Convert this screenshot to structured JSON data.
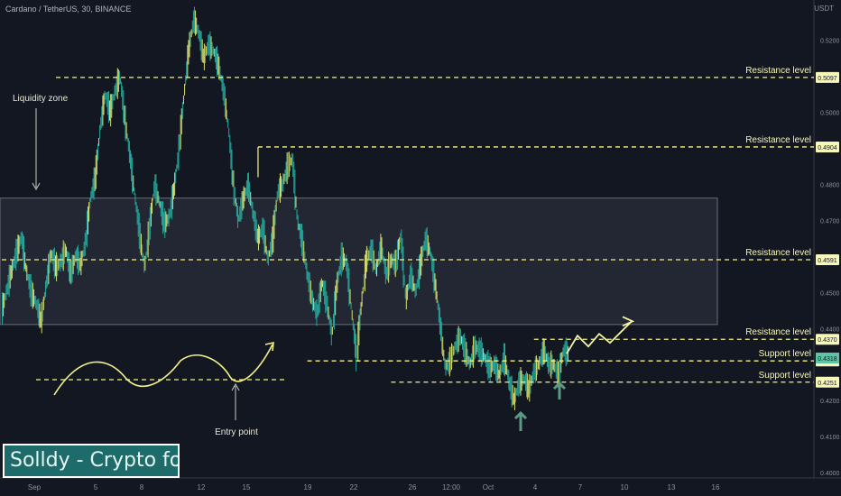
{
  "header": {
    "symbol_title": "Cardano / TetherUS, 30, BINANCE",
    "currency": "USDT"
  },
  "brand": "Solldy - Crypto for U",
  "chart_data": {
    "type": "line",
    "x": [
      "Sep",
      "5",
      "8",
      "12",
      "15",
      "19",
      "22",
      "26",
      "12:00",
      "Oct",
      "4",
      "7",
      "10",
      "13",
      "16"
    ],
    "ylim": [
      0.3985,
      0.5312
    ],
    "y_ticks": [
      "0.5200",
      "0.5000",
      "0.4800",
      "0.4700",
      "0.4500",
      "0.4400",
      "0.4200",
      "0.4100",
      "0.4000"
    ],
    "price_series": [
      0.445,
      0.4505,
      0.456,
      0.461,
      0.4655,
      0.456,
      0.45,
      0.447,
      0.442,
      0.452,
      0.461,
      0.457,
      0.4585,
      0.462,
      0.455,
      0.4605,
      0.4575,
      0.464,
      0.476,
      0.482,
      0.496,
      0.505,
      0.5,
      0.506,
      0.51,
      0.498,
      0.488,
      0.477,
      0.466,
      0.457,
      0.468,
      0.48,
      0.475,
      0.469,
      0.471,
      0.479,
      0.49,
      0.505,
      0.518,
      0.526,
      0.522,
      0.515,
      0.519,
      0.517,
      0.513,
      0.506,
      0.496,
      0.48,
      0.47,
      0.476,
      0.48,
      0.472,
      0.465,
      0.468,
      0.459,
      0.465,
      0.478,
      0.48,
      0.485,
      0.487,
      0.47,
      0.464,
      0.455,
      0.448,
      0.444,
      0.453,
      0.447,
      0.438,
      0.452,
      0.46,
      0.458,
      0.445,
      0.432,
      0.447,
      0.459,
      0.462,
      0.456,
      0.463,
      0.455,
      0.459,
      0.458,
      0.466,
      0.448,
      0.455,
      0.45,
      0.458,
      0.465,
      0.461,
      0.452,
      0.441,
      0.429,
      0.431,
      0.435,
      0.438,
      0.434,
      0.43,
      0.435,
      0.434,
      0.432,
      0.429,
      0.43,
      0.427,
      0.432,
      0.425,
      0.42,
      0.425,
      0.426,
      0.423,
      0.428,
      0.43,
      0.434,
      0.43,
      0.43,
      0.427,
      0.434,
      0.433
    ],
    "projection_path": [
      0.433,
      0.438,
      0.435,
      0.4385,
      0.436,
      0.439,
      0.442
    ],
    "levels": [
      {
        "name": "resistance-1",
        "label": "Resistance level",
        "price": "0.5097",
        "value": 0.5097,
        "x_start": 11,
        "style": "dashed"
      },
      {
        "name": "resistance-2",
        "label": "Resistance level",
        "price": "0.4904",
        "value": 0.4904,
        "x_start": 52,
        "style": "dashed"
      },
      {
        "name": "resistance-3",
        "label": "Resistance level",
        "price": "0.4591",
        "value": 0.4591,
        "x_start": 0,
        "style": "dashed"
      },
      {
        "name": "resistance-4",
        "label": "Resistance level",
        "price": "0.4370",
        "value": 0.437,
        "x_start": 108,
        "style": "dashed"
      },
      {
        "name": "support-1",
        "label": "Support level",
        "price": "0.4310",
        "value": 0.431,
        "x_start": 62,
        "style": "dashed"
      },
      {
        "name": "support-2",
        "label": "Support level",
        "price": "0.4251",
        "value": 0.4251,
        "x_start": 79,
        "style": "dashed"
      }
    ],
    "current_price": {
      "label": "0.4318",
      "value": 0.4318
    },
    "zone": {
      "label": "Liquidity zone",
      "top": 0.4762,
      "bottom": 0.4411
    },
    "annotations": {
      "entry": "Entry point"
    },
    "colors": {
      "background": "#131722",
      "candle_green": "#26a69a",
      "candle_yellow": "#d7de6f",
      "level_line": "#f5f582",
      "level_badge": "#f7f7b8",
      "current_badge": "#5ec4a5",
      "zone_fill": "#2a2e39",
      "zone_border": "#6a6d78",
      "marker_arrow": "#5c9a83"
    }
  }
}
